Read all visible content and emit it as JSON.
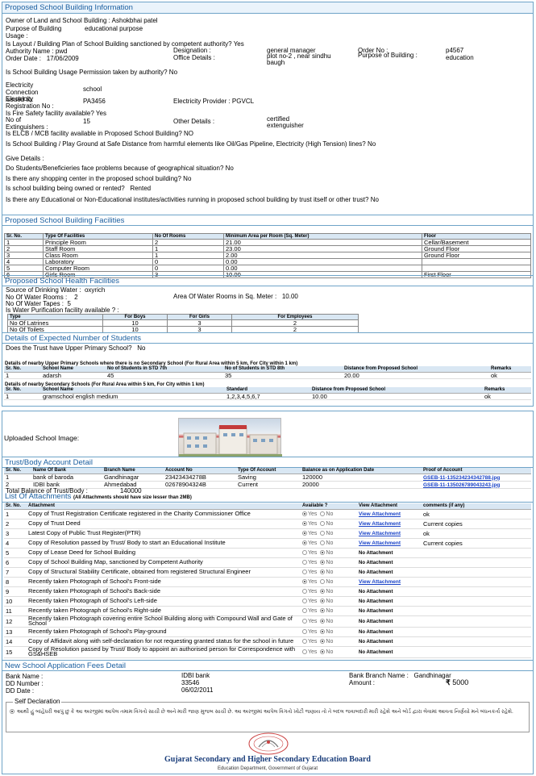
{
  "building_info": {
    "title": "Proposed School Building Information",
    "owner_label": "Owner of Land and School Building :",
    "owner_value": "Ashokbhai patel",
    "purpose_label": "Purpose of Building Usage :",
    "purpose_value": "educational purpose",
    "layout_q": "Is Layout / Building Plan of School Building sanctioned by competent authority?",
    "layout_a": "Yes",
    "authority_label": "Authority Name :",
    "authority_value": "pwd",
    "designation_label": "Designation :",
    "designation_value": "general manager",
    "order_no_label": "Order No :",
    "order_no_value": "p4567",
    "order_date_label": "Order Date :",
    "order_date_value": "17/06/2009",
    "office_label": "Office Details :",
    "office_value": "plot no-2 , near sindhu baugh",
    "purpose_building_label": "Purpose of Building :",
    "purpose_building_value": "education",
    "usage_perm_q": "Is School Building Usage Permission taken by authority?",
    "usage_perm_a": "No",
    "elec_conn_label": "Electricity Connection issued to:",
    "elec_conn_value": "school",
    "elec_reg_label": "Electricity Registration No :",
    "elec_reg_value": "PA3456",
    "elec_provider_label": "Electricity Provider :",
    "elec_provider_value": "PGVCL",
    "fire_q": "Is Fire Safety facility available?",
    "fire_a": "Yes",
    "extinguishers_label": "No of Extinguishers :",
    "extinguishers_value": "15",
    "other_details_label": "Other Details :",
    "other_details_value": "certified extenguisher",
    "elcb_q": "Is ELCB / MCB facility available in Proposed School Building?",
    "elcb_a": "NO",
    "hazard_q": "Is School Building / Play Ground at Safe Distance from harmful elements like Oil/Gas Pipeline, Electricity (High Tension) lines?",
    "hazard_a": "No",
    "give_details": "Give Details :",
    "geo_q": "Do Students/Beneficieries face problems because of geographical situation?",
    "geo_a": "No",
    "shopping_q": "Is there any shopping center in the proposed school building?",
    "shopping_a": "No",
    "owned_q": "Is school building being owned or rented?",
    "owned_a": "Rented",
    "nearby_q": "Is there any Educational or Non-Educational institutes/activities running in proposed school building by trust itself or other trust?",
    "nearby_a": "No"
  },
  "facilities": {
    "title": "Proposed School Building Facilities",
    "headers": [
      "Sr. No.",
      "Type Of Facilities",
      "No Of Rooms",
      "Minimum Area per Room (Sq. Meter)",
      "Floor"
    ],
    "rows": [
      [
        "1",
        "Principle Room",
        "2",
        "21.00",
        "Cellar/Basement"
      ],
      [
        "2",
        "Staff Room",
        "1",
        "23.00",
        "Ground Floor"
      ],
      [
        "3",
        "Class Room",
        "1",
        "2.00",
        "Ground Floor"
      ],
      [
        "4",
        "Laboratory",
        "0",
        "0.00",
        ""
      ],
      [
        "5",
        "Computer Room",
        "0",
        "0.00",
        ""
      ],
      [
        "6",
        "Girls Room",
        "3",
        "10.00",
        "First Floor"
      ]
    ]
  },
  "health": {
    "title": "Proposed School Health Facilities",
    "water_source_label": "Source of Drinking Water :",
    "water_source_value": "oxyrich",
    "water_rooms_label": "No Of Water Rooms :",
    "water_rooms_value": "2",
    "water_area_label": "Area Of Water Rooms in Sq. Meter :",
    "water_area_value": "10.00",
    "water_tapes_label": "No Of Water Tapes :",
    "water_tapes_value": "5",
    "purification_label": "Is Water Purification facility available ? :",
    "headers": [
      "Type",
      "For Boys",
      "For Girls",
      "For Employees"
    ],
    "rows": [
      [
        "No Of Latrines",
        "10",
        "3",
        "2"
      ],
      [
        "No Of Toilets",
        "10",
        "3",
        "2"
      ]
    ]
  },
  "students": {
    "title": "Details of Expected Number of Students",
    "upper_q": "Does the Trust have Upper Primary School?",
    "upper_a": "No",
    "upper_caption": "Details of nearby Upper Primary Schools where there is no Secondary School (For Rural Area within 5 km, For City within 1 km)",
    "upper_headers": [
      "Sr. No.",
      "School Name",
      "No of Students in STD 7th",
      "No of Students in STD 8th",
      "Distance from Proposed School",
      "Remarks"
    ],
    "upper_rows": [
      [
        "1",
        "adarsh",
        "45",
        "35",
        "20.00",
        "ok"
      ]
    ],
    "sec_caption": "Details of nearby Secondary Schools (For Rural Area within 5 km, For City within 1 km)",
    "sec_headers": [
      "Sr. No.",
      "School Name",
      "Standard",
      "Distance from Proposed School",
      "Remarks"
    ],
    "sec_rows": [
      [
        "1",
        "gramschool english medium",
        "1,2,3,4,5,6,7",
        "10.00",
        "ok"
      ]
    ]
  },
  "image": {
    "label": "Uploaded School Image:"
  },
  "bank": {
    "title": "Trust/Body Account Detail",
    "headers": [
      "Sr. No.",
      "Name Of Bank",
      "Branch Name",
      "Account No",
      "Type Of Account",
      "Balance as on Application Date",
      "Proof of Account"
    ],
    "rows": [
      [
        "1",
        "bank of baroda",
        "Gandhinagar",
        "23423434278B",
        "Saving",
        "120000",
        "GSEB-11-135234234342788.jpg"
      ],
      [
        "2",
        "IDBI bank",
        "Ahmedabad",
        "02678904324B",
        "Current",
        "20000",
        "GSEB-11-135026789043243.jpg"
      ]
    ],
    "total_label": "Total Balance of Trust/Body :",
    "total_value": "140000"
  },
  "attachments": {
    "title": "List Of Attachments",
    "note": "(All Attachments should have size lesser than 2MB)",
    "headers": [
      "Sr. No.",
      "Attachment",
      "Available ?",
      "View Attachment",
      "comments (if any)"
    ],
    "yes": "Yes",
    "no": "No",
    "view": "View Attachment",
    "none": "No Attachment",
    "rows": [
      {
        "no": "1",
        "name": "Copy of Trust Registration Certificate registered in the Charity Commissioner Office",
        "yes": true,
        "view": true,
        "comment": "ok"
      },
      {
        "no": "2",
        "name": "Copy of Trust Deed",
        "yes": true,
        "view": true,
        "comment": "Current copies"
      },
      {
        "no": "3",
        "name": "Latest Copy of Public Trust Register(PTR)",
        "yes": true,
        "view": true,
        "comment": "ok"
      },
      {
        "no": "4",
        "name": "Copy of Resolution passed by Trust/ Body to start an Educational Institute",
        "yes": true,
        "view": true,
        "comment": "Current copies"
      },
      {
        "no": "5",
        "name": "Copy of Lease Deed for School Building",
        "yes": false,
        "view": false,
        "comment": ""
      },
      {
        "no": "6",
        "name": "Copy of School Building Map, sanctioned by Competent Authority",
        "yes": false,
        "view": false,
        "comment": ""
      },
      {
        "no": "7",
        "name": "Copy of Structural Stability Certificate, obtained from registered Structural Engineer",
        "yes": false,
        "view": false,
        "comment": ""
      },
      {
        "no": "8",
        "name": "Recently taken Photograph of School's Front-side",
        "yes": true,
        "view": true,
        "comment": ""
      },
      {
        "no": "9",
        "name": "Recently taken Photograph of School's Back-side",
        "yes": false,
        "view": false,
        "comment": ""
      },
      {
        "no": "10",
        "name": "Recently taken Photograph of School's Left-side",
        "yes": false,
        "view": false,
        "comment": ""
      },
      {
        "no": "11",
        "name": "Recently taken Photograph of School's Right-side",
        "yes": false,
        "view": false,
        "comment": ""
      },
      {
        "no": "12",
        "name": "Recently taken Photograph covering entire School Building along with Compound Wall and Gate of School",
        "yes": false,
        "view": false,
        "comment": ""
      },
      {
        "no": "13",
        "name": "Recently taken Photograph of School's Play-ground",
        "yes": false,
        "view": false,
        "comment": ""
      },
      {
        "no": "14",
        "name": "Copy of Affidavit along with self-declaration for not requesting granted status for the school in future",
        "yes": false,
        "view": false,
        "comment": ""
      },
      {
        "no": "15",
        "name": "Copy of Resolution passed by Trust/ Body to appoint an authorised person for Correspondence with GS&HSEB",
        "yes": false,
        "view": false,
        "comment": ""
      }
    ]
  },
  "fees": {
    "title": "New School Application Fees Detail",
    "bank_name_label": "Bank Name :",
    "bank_name_value": "IDBI bank",
    "branch_label": "Bank Branch Name :",
    "branch_value": "Gandhinagar",
    "dd_no_label": "DD Number :",
    "dd_no_value": "33546",
    "amount_label": "Amount :",
    "amount_value": "5000",
    "dd_date_label": "DD Date :",
    "dd_date_value": "06/02/2011"
  },
  "declaration": {
    "title": "Self Declaration",
    "text": "આથી હું બાંહેધરી આપું છું કે આ અરજીમાં આપેલ તમામ વિગતો સાચી છે અને મારી જાણ મુજબ સાચી છે. આ અરજીમાં આપેલ વિગતો ખોટી જણાય તો તે બદલ જવાબદારી મારી રહેશે અને બોર્ડ દ્વારા લેવામાં આવતા નિર્ણયો મને બંધનકર્તા રહેશે."
  },
  "footer": {
    "board": "Gujarat Secondary and Higher Secondary Education Board",
    "dept": "Education Department, Government of Gujarat"
  },
  "colors": {
    "accent": "#1b5fa0",
    "border": "#6fa4c8",
    "header_bg": "#d9e7f3",
    "link": "#1a43c7"
  }
}
